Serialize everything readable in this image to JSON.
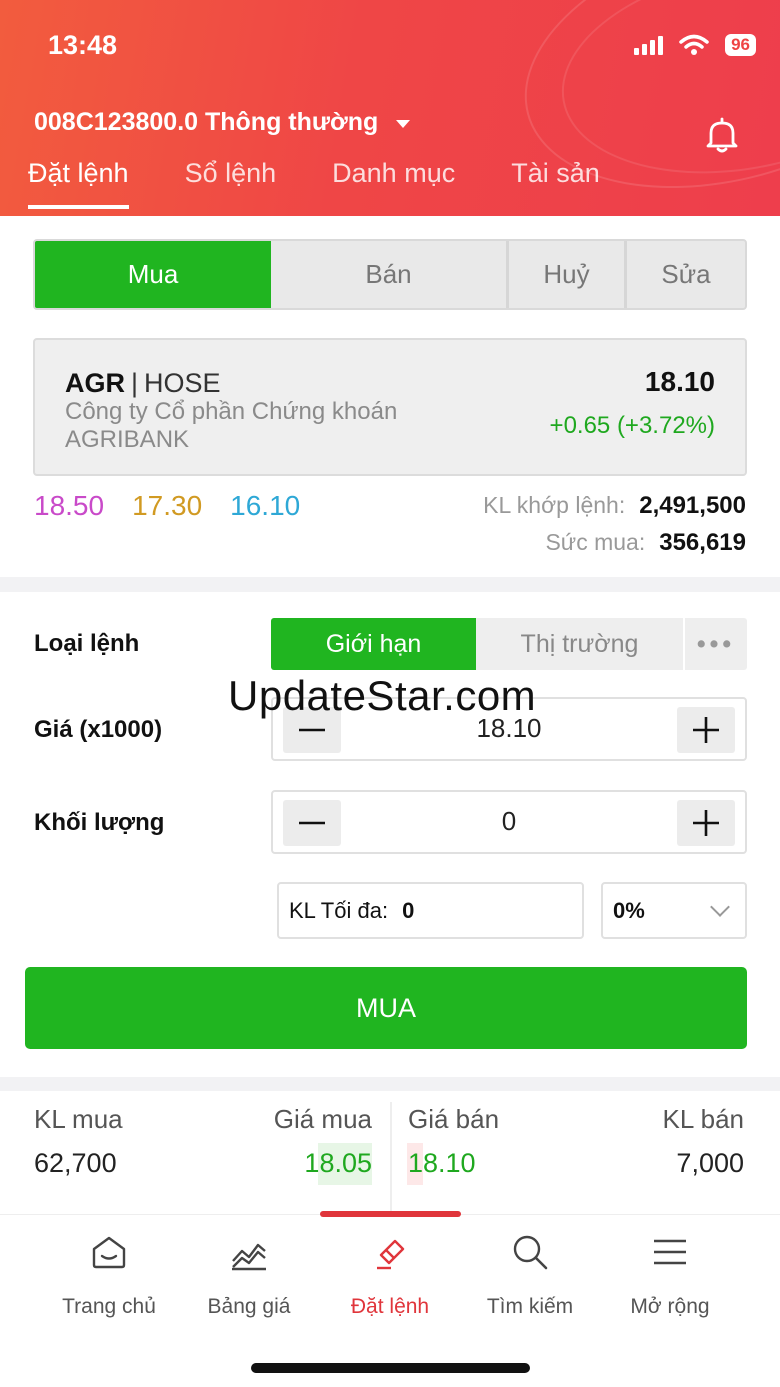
{
  "status": {
    "time": "13:48",
    "battery": "96"
  },
  "header": {
    "account": "008C123800.0 Thông thường",
    "tabs": [
      "Đặt lệnh",
      "Sổ lệnh",
      "Danh mục",
      "Tài sản"
    ],
    "active_tab": 0
  },
  "side_tabs": {
    "buy": "Mua",
    "sell": "Bán",
    "cancel": "Huỷ",
    "edit": "Sửa",
    "active": "buy"
  },
  "stock": {
    "symbol": "AGR",
    "exchange": "HOSE",
    "name": "Công ty Cổ phần Chứng khoán AGRIBANK",
    "price": "18.10",
    "change": "+0.65 (+3.72%)",
    "ceiling": "18.50",
    "reference": "17.30",
    "floor": "16.10",
    "matched_label": "KL khớp lệnh:",
    "matched_value": "2,491,500",
    "buying_power_label": "Sức mua:",
    "buying_power_value": "356,619"
  },
  "form": {
    "order_type_label": "Loại lệnh",
    "order_types": {
      "limit": "Giới hạn",
      "market": "Thị trường",
      "more": "•••"
    },
    "active_order_type": "limit",
    "price_label": "Giá (x1000)",
    "price_value": "18.10",
    "qty_label": "Khối lượng",
    "qty_value": "0",
    "max_label": "KL Tối đa:",
    "max_value": "0",
    "percent_value": "0%",
    "submit": "MUA"
  },
  "watermark": "UpdateStar.com",
  "order_book": {
    "headers": {
      "bid_vol": "KL mua",
      "bid_price": "Giá mua",
      "ask_price": "Giá bán",
      "ask_vol": "KL bán"
    },
    "rows": [
      {
        "bid_vol": "62,700",
        "bid_price": "18.05",
        "ask_price": "18.10",
        "ask_vol": "7,000"
      }
    ]
  },
  "colors": {
    "brand_red": "#ee3e4c",
    "buy_green": "#20b520",
    "ceiling": "#c94ac9",
    "reference": "#d19a22",
    "floor": "#2ea8d6"
  },
  "bottom_nav": [
    {
      "label": "Trang chủ",
      "icon": "home-icon"
    },
    {
      "label": "Bảng giá",
      "icon": "chart-icon"
    },
    {
      "label": "Đặt lệnh",
      "icon": "order-icon",
      "active": true
    },
    {
      "label": "Tìm kiếm",
      "icon": "search-icon"
    },
    {
      "label": "Mở rộng",
      "icon": "menu-icon"
    }
  ]
}
